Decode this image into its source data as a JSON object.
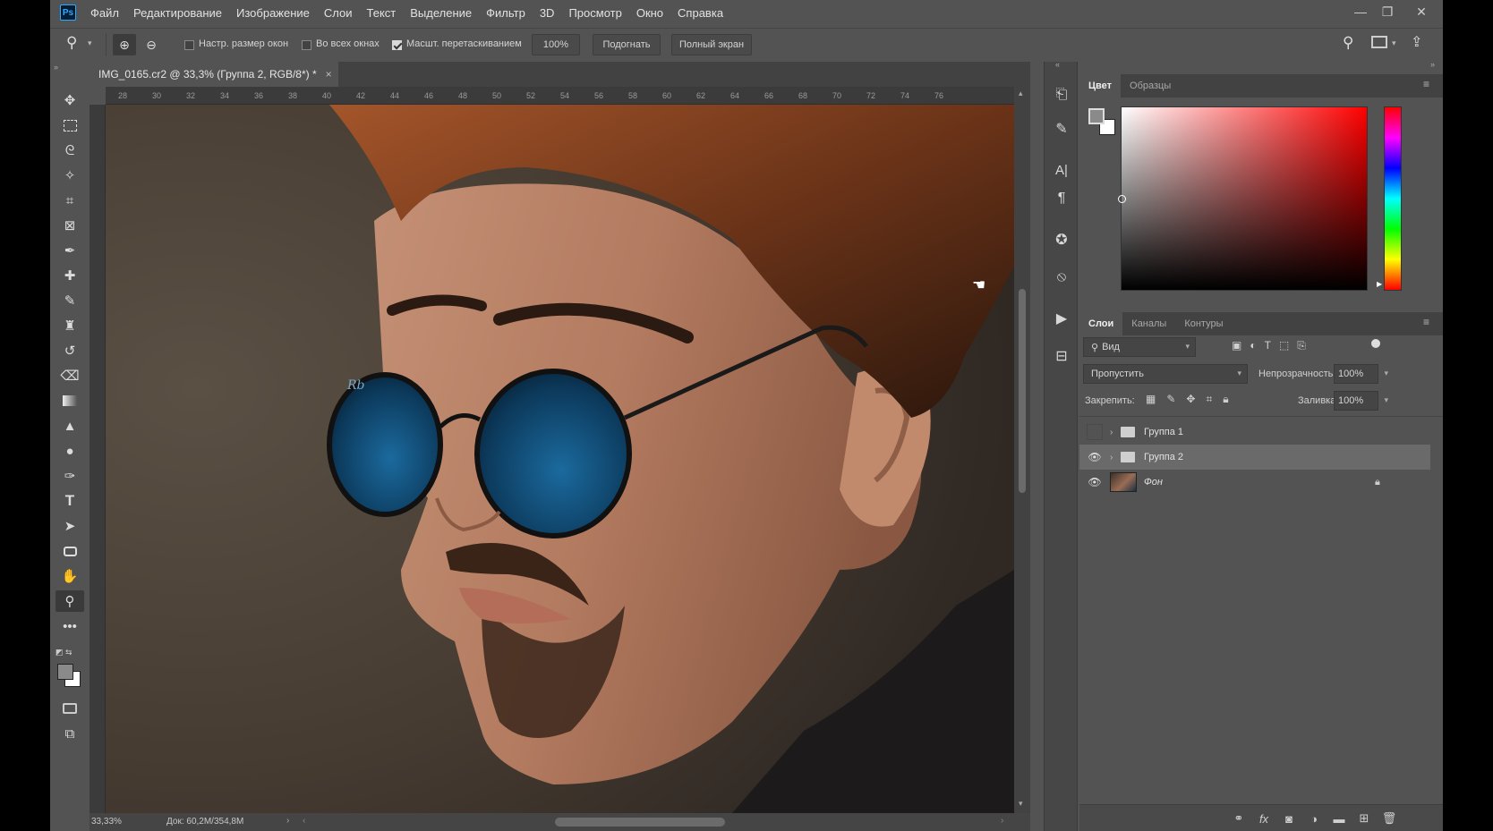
{
  "app": {
    "logo": "Ps"
  },
  "menu": [
    "Файл",
    "Редактирование",
    "Изображение",
    "Слои",
    "Текст",
    "Выделение",
    "Фильтр",
    "3D",
    "Просмотр",
    "Окно",
    "Справка"
  ],
  "options": {
    "resize_windows": "Настр. размер окон",
    "resize_windows_checked": false,
    "all_windows": "Во всех окнах",
    "all_windows_checked": false,
    "scrubby_zoom": "Масшт. перетаскиванием",
    "scrubby_zoom_checked": true,
    "zoom_value": "100%",
    "fit_button": "Подогнать",
    "fullscreen_button": "Полный экран"
  },
  "document": {
    "tab_title": "IMG_0165.cr2 @ 33,3% (Группа 2, RGB/8*) *",
    "close": "×",
    "zoom_status": "33,33%",
    "doc_info": "Док: 60,2M/354,8M"
  },
  "ruler_h": [
    "28",
    "30",
    "32",
    "34",
    "36",
    "38",
    "40",
    "42",
    "44",
    "46",
    "48",
    "50",
    "52",
    "54",
    "56",
    "58",
    "60",
    "62",
    "64",
    "66",
    "68",
    "70",
    "72",
    "74",
    "76"
  ],
  "color_panel": {
    "tabs": [
      "Цвет",
      "Образцы"
    ],
    "active_tab": 0,
    "hue": "#ff0000"
  },
  "layers_panel": {
    "tabs": [
      "Слои",
      "Каналы",
      "Контуры"
    ],
    "active_tab": 0,
    "filter_placeholder": "Вид",
    "blend_mode": "Пропустить",
    "opacity_label": "Непрозрачность:",
    "opacity_value": "100%",
    "lock_label": "Закрепить:",
    "fill_label": "Заливка:",
    "fill_value": "100%",
    "layers": [
      {
        "name": "Группа 1",
        "visible": false,
        "type": "group",
        "selected": false
      },
      {
        "name": "Группа 2",
        "visible": true,
        "type": "group",
        "selected": true
      },
      {
        "name": "Фон",
        "visible": true,
        "type": "background",
        "selected": false,
        "locked": true
      }
    ]
  },
  "colors": {
    "foreground": "#8a8a8a",
    "background": "#ffffff",
    "accent": "#31a8ff",
    "lens": "#0d3d63"
  }
}
